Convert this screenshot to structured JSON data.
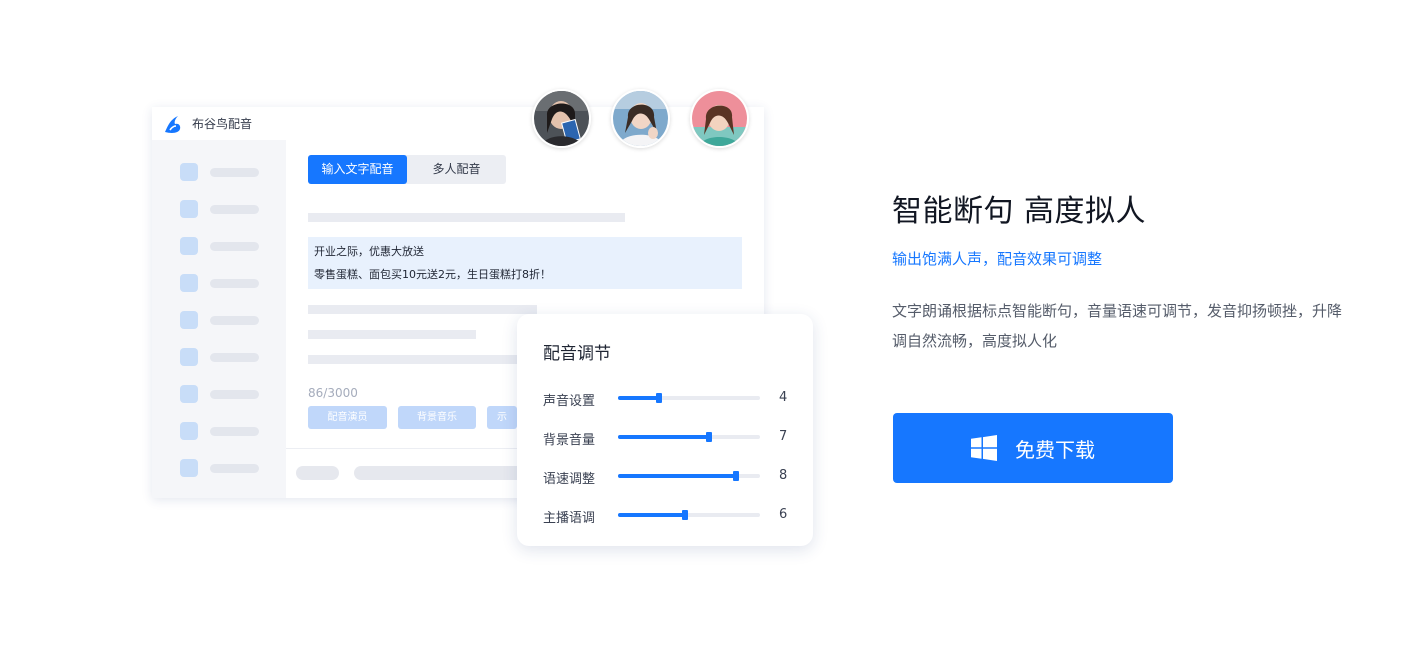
{
  "app": {
    "name": "布谷鸟配音",
    "tabs": [
      {
        "label": "输入文字配音",
        "active": true
      },
      {
        "label": "多人配音",
        "active": false
      }
    ],
    "text_lines": [
      "开业之际，优惠大放送",
      "零售蛋糕、面包买10元送2元，生日蛋糕打8折！"
    ],
    "counter": "86/3000",
    "chips": [
      "配音演员",
      "背景音乐",
      "示"
    ]
  },
  "avatars": [
    {
      "name": "voice-actor-1",
      "bg": "#5a5e63"
    },
    {
      "name": "voice-actor-2",
      "bg": "#7aa6c8"
    },
    {
      "name": "voice-actor-3",
      "bg": "#e88a95"
    }
  ],
  "panel": {
    "title": "配音调节",
    "sliders": [
      {
        "label": "声音设置",
        "value": "4",
        "level": 0.29
      },
      {
        "label": "背景音量",
        "value": "7",
        "level": 0.64
      },
      {
        "label": "语速调整",
        "value": "8",
        "level": 0.83
      },
      {
        "label": "主播语调",
        "value": "6",
        "level": 0.47
      }
    ]
  },
  "feature": {
    "headline": "智能断句 高度拟人",
    "subheadline": "输出饱满人声，配音效果可调整",
    "description": "文字朗诵根据标点智能断句，音量语速可调节，发音抑扬顿挫，升降调自然流畅，高度拟人化",
    "download_label": "免费下载"
  },
  "colors": {
    "accent": "#1677ff",
    "highlight_bg": "#e8f1fd",
    "chip_bg": "#c0d7fa"
  }
}
